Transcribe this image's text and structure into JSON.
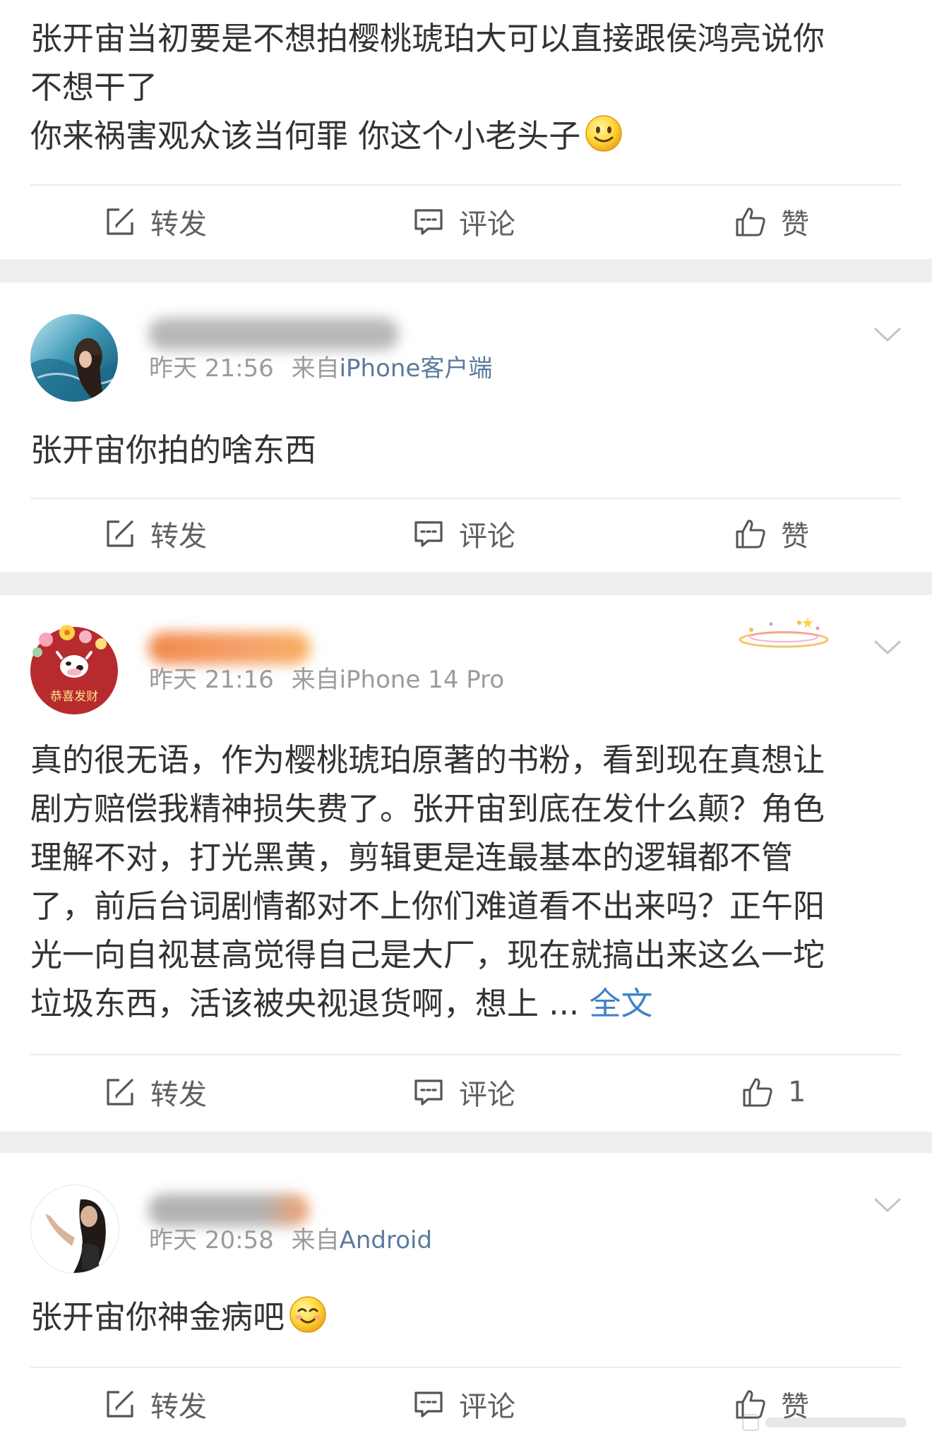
{
  "posts": [
    {
      "text_lines": [
        "张开宙当初要是不想拍樱桃琥珀大可以直接跟侯鸿亮说你",
        "不想干了",
        "你来祸害观众该当何罪 你这个小老头子"
      ],
      "emoji": "smile-emoji",
      "actions": {
        "repost": "转发",
        "comment": "评论",
        "like": "赞"
      }
    },
    {
      "time": "昨天 21:56",
      "from": "来自",
      "source": "iPhone客户端",
      "text": "张开宙你拍的啥东西",
      "actions": {
        "repost": "转发",
        "comment": "评论",
        "like": "赞"
      }
    },
    {
      "time": "昨天 21:16",
      "from": "来自",
      "source": "iPhone 14 Pro",
      "avatar_text": "恭喜发财",
      "text_lines": [
        "真的很无语，作为樱桃琥珀原著的书粉，看到现在真想让",
        "剧方赔偿我精神损失费了。张开宙到底在发什么颠？角色",
        "理解不对，打光黑黄，剪辑更是连最基本的逻辑都不管",
        "了，前后台词剧情都对不上你们难道看不出来吗？正午阳",
        "光一向自视甚高觉得自己是大厂，现在就搞出来这么一坨",
        "垃圾东西，活该被央视退货啊，想上 ..."
      ],
      "more": "全文",
      "actions": {
        "repost": "转发",
        "comment": "评论",
        "like_count": "1"
      }
    },
    {
      "time": "昨天 20:58",
      "from": "来自",
      "source": "Android",
      "text": "张开宙你神金病吧",
      "emoji": "blush-emoji",
      "actions": {
        "repost": "转发",
        "comment": "评论",
        "like": "赞"
      }
    }
  ],
  "colors": {
    "text": "#333333",
    "meta": "#9b9b9b",
    "source_link": "#5b7a9e",
    "full_text_link": "#3e84c6",
    "separator": "#eeeeee",
    "action": "#606060"
  },
  "icons": [
    "repost-icon",
    "comment-icon",
    "like-icon",
    "chevron-down-icon",
    "vip-decoration-icon"
  ]
}
